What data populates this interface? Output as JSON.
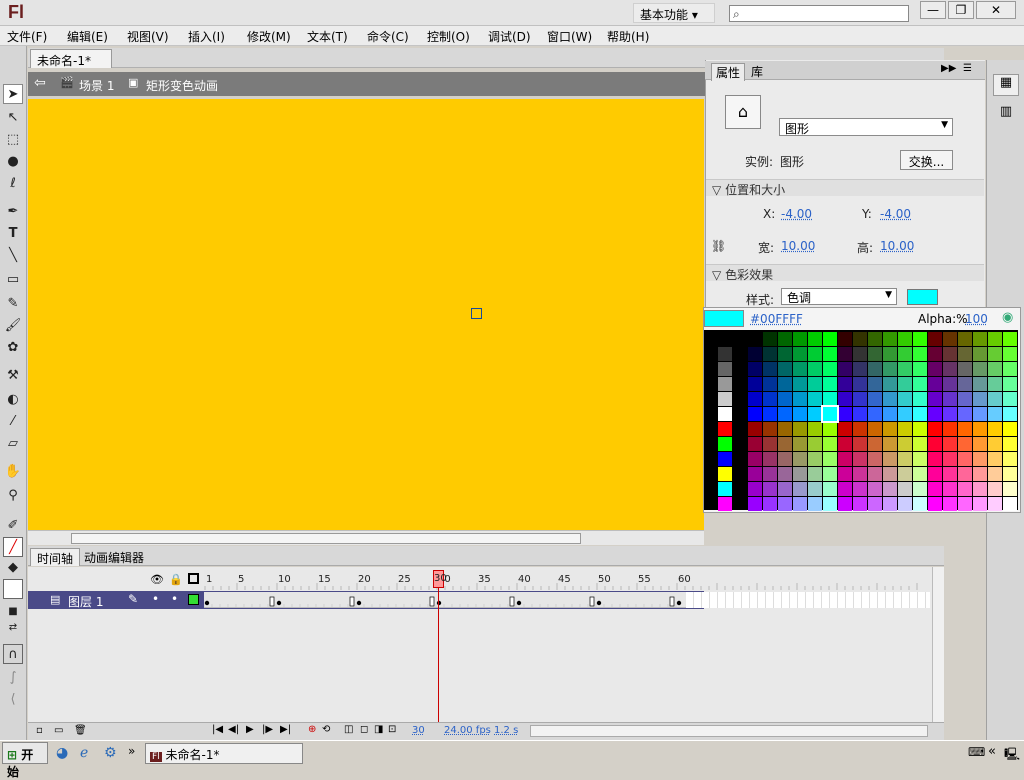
{
  "app": {
    "logo": "Fl",
    "workspace": "基本功能 ▾",
    "search_placeholder": ""
  },
  "window_controls": {
    "minimize": "—",
    "restore": "❐",
    "close": "✕"
  },
  "menu": [
    "文件(F)",
    "编辑(E)",
    "视图(V)",
    "插入(I)",
    "修改(M)",
    "文本(T)",
    "命令(C)",
    "控制(O)",
    "调试(D)",
    "窗口(W)",
    "帮助(H)"
  ],
  "document": {
    "tab_title": "未命名-1*",
    "tab_close": "✕"
  },
  "editbar": {
    "back": "⇦",
    "scene": "场景 1",
    "symbol": "矩形变色动画"
  },
  "stage": {
    "background": "#ffcb00"
  },
  "timeline": {
    "tabs": [
      "时间轴",
      "动画编辑器"
    ],
    "layer_name": "图层 1",
    "ruler_ticks": [
      "1",
      "5",
      "10",
      "15",
      "20",
      "25",
      "30",
      "35",
      "40",
      "45",
      "50",
      "55",
      "60"
    ],
    "current_frame": 30,
    "status": {
      "frame": "30",
      "fps": "24.00 fps",
      "time": "1.2 s"
    }
  },
  "properties": {
    "tabs": [
      "属性",
      "库"
    ],
    "type_dropdown": "图形",
    "instance_label": "实例:",
    "instance_value": "图形",
    "swap_button": "交换...",
    "section_position": "位置和大小",
    "x_label": "X:",
    "x_value": "-4.00",
    "y_label": "Y:",
    "y_value": "-4.00",
    "w_label": "宽:",
    "w_value": "10.00",
    "h_label": "高:",
    "h_value": "10.00",
    "section_color": "色彩效果",
    "style_label": "样式:",
    "style_value": "色调",
    "tint_color": "#00ffff"
  },
  "palette": {
    "hex": "#00FFFF",
    "alpha_label": "Alpha:%",
    "alpha_value": "100",
    "selected_color": "#00ffff"
  },
  "taskbar": {
    "start": "开始",
    "item": "未命名-1*",
    "chevron": "«"
  }
}
